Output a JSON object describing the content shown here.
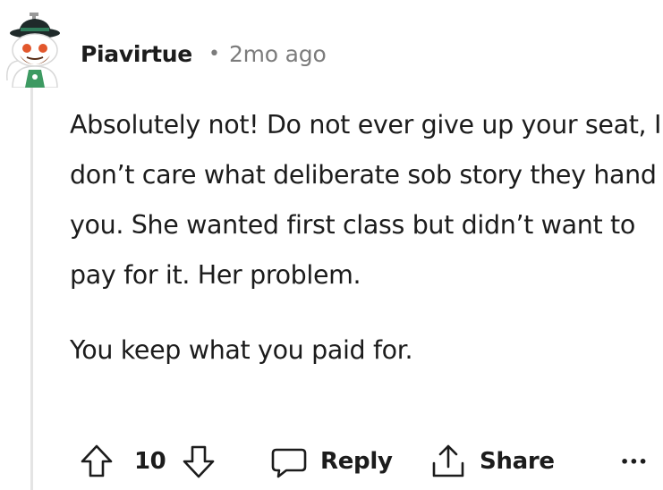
{
  "comment": {
    "author": "Piavirtue",
    "separator": "•",
    "timestamp": "2mo ago",
    "avatar_icon": "snoo-avatar-icon",
    "paragraphs": [
      "Absolutely not! Do not ever give up your seat, I don’t care what deliberate sob story they hand you. She wanted first class but didn’t want to pay for it. Her problem.",
      "You keep what you paid for."
    ]
  },
  "actions": {
    "upvote_icon": "upvote-arrow-icon",
    "vote_count": "10",
    "downvote_icon": "downvote-arrow-icon",
    "reply_icon": "speech-bubble-icon",
    "reply_label": "Reply",
    "share_icon": "share-icon",
    "share_label": "Share",
    "more_label": "•••"
  }
}
